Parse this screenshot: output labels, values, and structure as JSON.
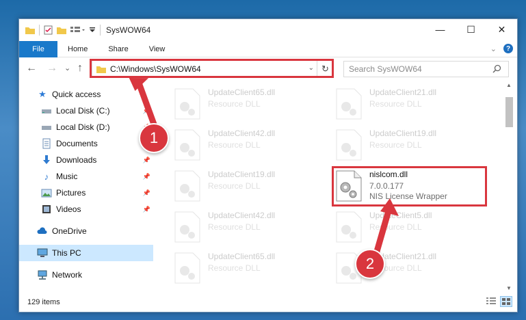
{
  "window": {
    "title": "SysWOW64",
    "buttons": {
      "minimize": "—",
      "maximize": "☐",
      "close": "✕"
    }
  },
  "ribbon": {
    "file_label": "File",
    "tabs": [
      "Home",
      "Share",
      "View"
    ],
    "help": "?"
  },
  "navigation": {
    "back": "←",
    "forward": "→",
    "recent": "⌄",
    "up": "↑",
    "address": "C:\\Windows\\SysWOW64",
    "refresh": "↻",
    "search_placeholder": "Search SysWOW64"
  },
  "sidebar": {
    "items": [
      {
        "label": "Quick access",
        "icon": "star-icon"
      },
      {
        "label": "Local Disk (C:)",
        "icon": "drive-icon"
      },
      {
        "label": "Local Disk (D:)",
        "icon": "drive-icon"
      },
      {
        "label": "Documents",
        "icon": "documents-icon"
      },
      {
        "label": "Downloads",
        "icon": "download-icon"
      },
      {
        "label": "Music",
        "icon": "music-icon"
      },
      {
        "label": "Pictures",
        "icon": "pictures-icon"
      },
      {
        "label": "Videos",
        "icon": "videos-icon"
      },
      {
        "label": "OneDrive",
        "icon": "cloud-icon"
      },
      {
        "label": "This PC",
        "icon": "pc-icon"
      },
      {
        "label": "Network",
        "icon": "network-icon"
      }
    ]
  },
  "files": [
    {
      "name": "UpdateClient65.dll",
      "sub": "Resource DLL"
    },
    {
      "name": "UpdateClient21.dll",
      "sub": "Resource DLL"
    },
    {
      "name": "UpdateClient42.dll",
      "sub": "Resource DLL"
    },
    {
      "name": "UpdateClient19.dll",
      "sub": "Resource DLL"
    },
    {
      "name": "UpdateClient19.dll",
      "sub": "Resource DLL"
    },
    {
      "name": "nislcom.dll",
      "version": "7.0.0.177",
      "sub": "NIS License Wrapper"
    },
    {
      "name": "UpdateClient42.dll",
      "sub": "Resource DLL"
    },
    {
      "name": "UpdateClient5.dll",
      "sub": "Resource DLL"
    },
    {
      "name": "UpdateClient65.dll",
      "sub": "Resource DLL"
    },
    {
      "name": "UpdateClient21.dll",
      "sub": "Resource DLL"
    }
  ],
  "status": {
    "item_count": "129 items"
  },
  "annotations": {
    "step1": "1",
    "step2": "2"
  },
  "colors": {
    "accent": "#1979ca",
    "annotation": "#d9363e",
    "selected": "#cce8ff"
  }
}
